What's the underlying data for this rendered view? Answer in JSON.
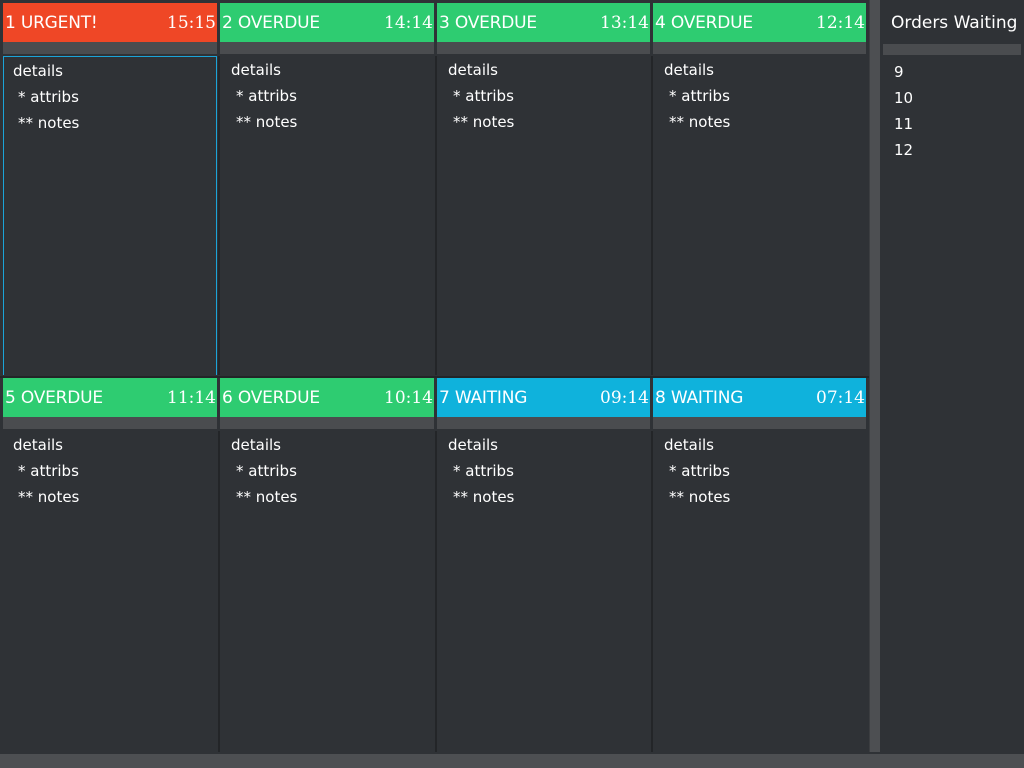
{
  "colors": {
    "urgent": "#ef4726",
    "overdue": "#2ecc71",
    "waiting": "#0fb2dc",
    "background": "#2f3236",
    "selection_border": "#1ba4d8"
  },
  "tickets": [
    {
      "label": "1 URGENT!",
      "time": "15:15",
      "status": "urgent",
      "details": "details",
      "attribs": "* attribs",
      "notes": "** notes"
    },
    {
      "label": "2 OVERDUE",
      "time": "14:14",
      "status": "overdue",
      "details": "details",
      "attribs": "* attribs",
      "notes": "** notes"
    },
    {
      "label": "3 OVERDUE",
      "time": "13:14",
      "status": "overdue",
      "details": "details",
      "attribs": "* attribs",
      "notes": "** notes"
    },
    {
      "label": "4 OVERDUE",
      "time": "12:14",
      "status": "overdue",
      "details": "details",
      "attribs": "* attribs",
      "notes": "** notes"
    },
    {
      "label": "5 OVERDUE",
      "time": "11:14",
      "status": "overdue",
      "details": "details",
      "attribs": "* attribs",
      "notes": "** notes"
    },
    {
      "label": "6 OVERDUE",
      "time": "10:14",
      "status": "overdue",
      "details": "details",
      "attribs": "* attribs",
      "notes": "** notes"
    },
    {
      "label": "7 WAITING",
      "time": "09:14",
      "status": "waiting",
      "details": "details",
      "attribs": "* attribs",
      "notes": "** notes"
    },
    {
      "label": "8 WAITING",
      "time": "07:14",
      "status": "waiting",
      "details": "details",
      "attribs": "* attribs",
      "notes": "** notes"
    }
  ],
  "waiting_panel": {
    "title": "Orders Waiting",
    "orders": [
      "9",
      "10",
      "11",
      "12"
    ]
  }
}
